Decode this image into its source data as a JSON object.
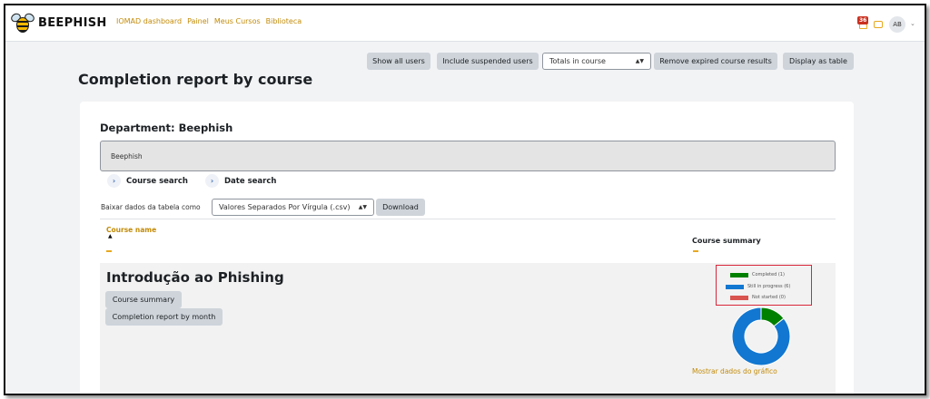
{
  "app": {
    "brand": "BEEPHISH"
  },
  "nav": {
    "links": [
      "IOMAD dashboard",
      "Painel",
      "Meus Cursos",
      "Biblioteca"
    ],
    "notifications_count": "36",
    "user_initials": "AB"
  },
  "toolbar": {
    "show_all_users": "Show all users",
    "include_suspended": "Include suspended users",
    "totals_select_value": "Totals in course",
    "remove_expired": "Remove expired course results",
    "display_as_table": "Display as table"
  },
  "page": {
    "title": "Completion report by course"
  },
  "department": {
    "title": "Department: Beephish",
    "selected": "Beephish"
  },
  "search": {
    "course_search": "Course search",
    "date_search": "Date search"
  },
  "download": {
    "label": "Baixar dados da tabela como",
    "format_value": "Valores Separados Por Vírgula (.csv)",
    "button": "Download"
  },
  "table": {
    "col_course_name": "Course name",
    "col_course_summary": "Course summary",
    "rows": [
      {
        "course": "Introdução ao Phishing",
        "course_summary_button": "Course summary",
        "completion_by_month_button": "Completion report by month",
        "chart_link": "Mostrar dados do gráfico"
      }
    ]
  },
  "colors": {
    "accent": "#c38b08",
    "completed": "#008000",
    "in_progress": "#1177d1",
    "not_started": "#d9534f",
    "highlight_border": "#d9263a"
  },
  "chart_data": {
    "type": "pie",
    "donut": true,
    "legend_position": "top",
    "categories": [
      "Completed (1)",
      "Still in progress (6)",
      "Not started (0)"
    ],
    "values": [
      1,
      6,
      0
    ],
    "colors": [
      "#008000",
      "#1177d1",
      "#d9534f"
    ]
  }
}
